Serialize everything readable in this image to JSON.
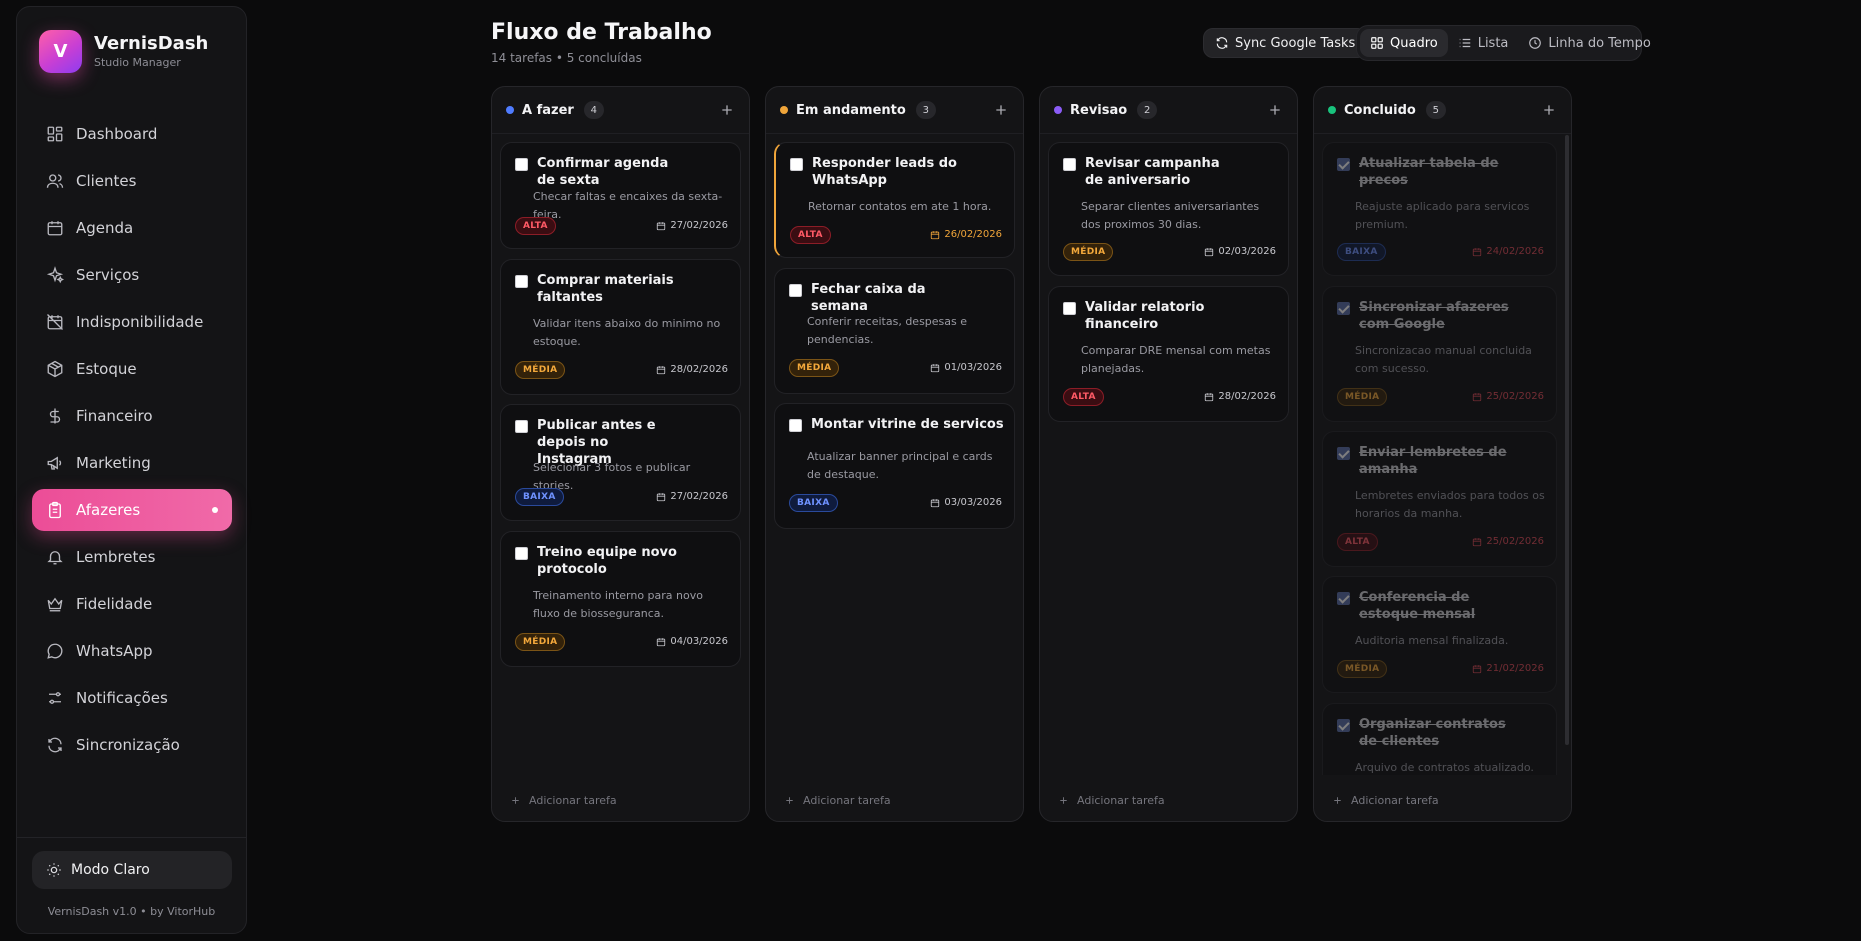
{
  "app": {
    "name": "VernisDash",
    "subtitle": "Studio Manager",
    "logo_letter": "V",
    "footer": "VernisDash v1.0 • by VitorHub",
    "mode_toggle": "Modo Claro"
  },
  "sidebar": {
    "items": [
      {
        "label": "Dashboard",
        "icon": "grid-icon"
      },
      {
        "label": "Clientes",
        "icon": "users-icon"
      },
      {
        "label": "Agenda",
        "icon": "calendar-icon"
      },
      {
        "label": "Serviços",
        "icon": "sparkles-icon"
      },
      {
        "label": "Indisponibilidade",
        "icon": "calendar-off-icon"
      },
      {
        "label": "Estoque",
        "icon": "package-icon"
      },
      {
        "label": "Financeiro",
        "icon": "dollar-icon"
      },
      {
        "label": "Marketing",
        "icon": "megaphone-icon"
      },
      {
        "label": "Afazeres",
        "icon": "clipboard-icon",
        "active": true
      },
      {
        "label": "Lembretes",
        "icon": "bell-icon"
      },
      {
        "label": "Fidelidade",
        "icon": "crown-icon"
      },
      {
        "label": "WhatsApp",
        "icon": "chat-icon"
      },
      {
        "label": "Notificações",
        "icon": "sliders-icon"
      },
      {
        "label": "Sincronização",
        "icon": "refresh-icon"
      }
    ]
  },
  "header": {
    "title": "Fluxo de Trabalho",
    "subtitle": "14 tarefas • 5 concluídas",
    "sync_label": "Sync Google Tasks",
    "views": [
      {
        "label": "Quadro",
        "icon": "grid-icon",
        "active": true
      },
      {
        "label": "Lista",
        "icon": "list-icon"
      },
      {
        "label": "Linha do Tempo",
        "icon": "clock-icon"
      }
    ]
  },
  "colors": {
    "accent": "#ec4d97",
    "todo": "#4f7cff",
    "in_progress": "#f0a53a",
    "review": "#8b5cf6",
    "done": "#19c37d"
  },
  "add_task_label": "Adicionar tarefa",
  "columns": [
    {
      "title": "A fazer",
      "count": "4",
      "cards": [
        {
          "title": "Confirmar agenda de sexta",
          "desc": "Checar faltas e encaixes da sexta-feira.",
          "priority": "ALTA",
          "date": "27/02/2026"
        },
        {
          "title": "Comprar materiais faltantes",
          "desc": "Validar itens abaixo do minimo no estoque.",
          "priority": "MÉDIA",
          "date": "28/02/2026"
        },
        {
          "title": "Publicar antes e depois no Instagram",
          "desc": "Selecionar 3 fotos e publicar stories.",
          "priority": "BAIXA",
          "date": "27/02/2026"
        },
        {
          "title": "Treino equipe novo protocolo",
          "desc": "Treinamento interno para novo fluxo de biosseguranca.",
          "priority": "MÉDIA",
          "date": "04/03/2026"
        }
      ]
    },
    {
      "title": "Em andamento",
      "count": "3",
      "cards": [
        {
          "title": "Responder leads do WhatsApp",
          "desc": "Retornar contatos em ate 1 hora.",
          "priority": "ALTA",
          "date": "26/02/2026"
        },
        {
          "title": "Fechar caixa da semana",
          "desc": "Conferir receitas, despesas e pendencias.",
          "priority": "MÉDIA",
          "date": "01/03/2026"
        },
        {
          "title": "Montar vitrine de servicos",
          "desc": "Atualizar banner principal e cards de destaque.",
          "priority": "BAIXA",
          "date": "03/03/2026"
        }
      ]
    },
    {
      "title": "Revisao",
      "count": "2",
      "cards": [
        {
          "title": "Revisar campanha de aniversario",
          "desc": "Separar clientes aniversariantes dos proximos 30 dias.",
          "priority": "MÉDIA",
          "date": "02/03/2026"
        },
        {
          "title": "Validar relatorio financeiro",
          "desc": "Comparar DRE mensal com metas planejadas.",
          "priority": "ALTA",
          "date": "28/02/2026"
        }
      ]
    },
    {
      "title": "Concluido",
      "count": "5",
      "cards": [
        {
          "title": "Atualizar tabela de precos",
          "desc": "Reajuste aplicado para servicos premium.",
          "priority": "BAIXA",
          "date": "24/02/2026"
        },
        {
          "title": "Sincronizar afazeres com Google",
          "desc": "Sincronizacao manual concluida com sucesso.",
          "priority": "MÉDIA",
          "date": "25/02/2026"
        },
        {
          "title": "Enviar lembretes de amanha",
          "desc": "Lembretes enviados para todos os horarios da manha.",
          "priority": "ALTA",
          "date": "25/02/2026"
        },
        {
          "title": "Conferencia de estoque mensal",
          "desc": "Auditoria mensal finalizada.",
          "priority": "MÉDIA",
          "date": "21/02/2026"
        },
        {
          "title": "Organizar contratos de clientes",
          "desc": "Arquivo de contratos atualizado.",
          "priority": "",
          "date": ""
        }
      ]
    }
  ]
}
